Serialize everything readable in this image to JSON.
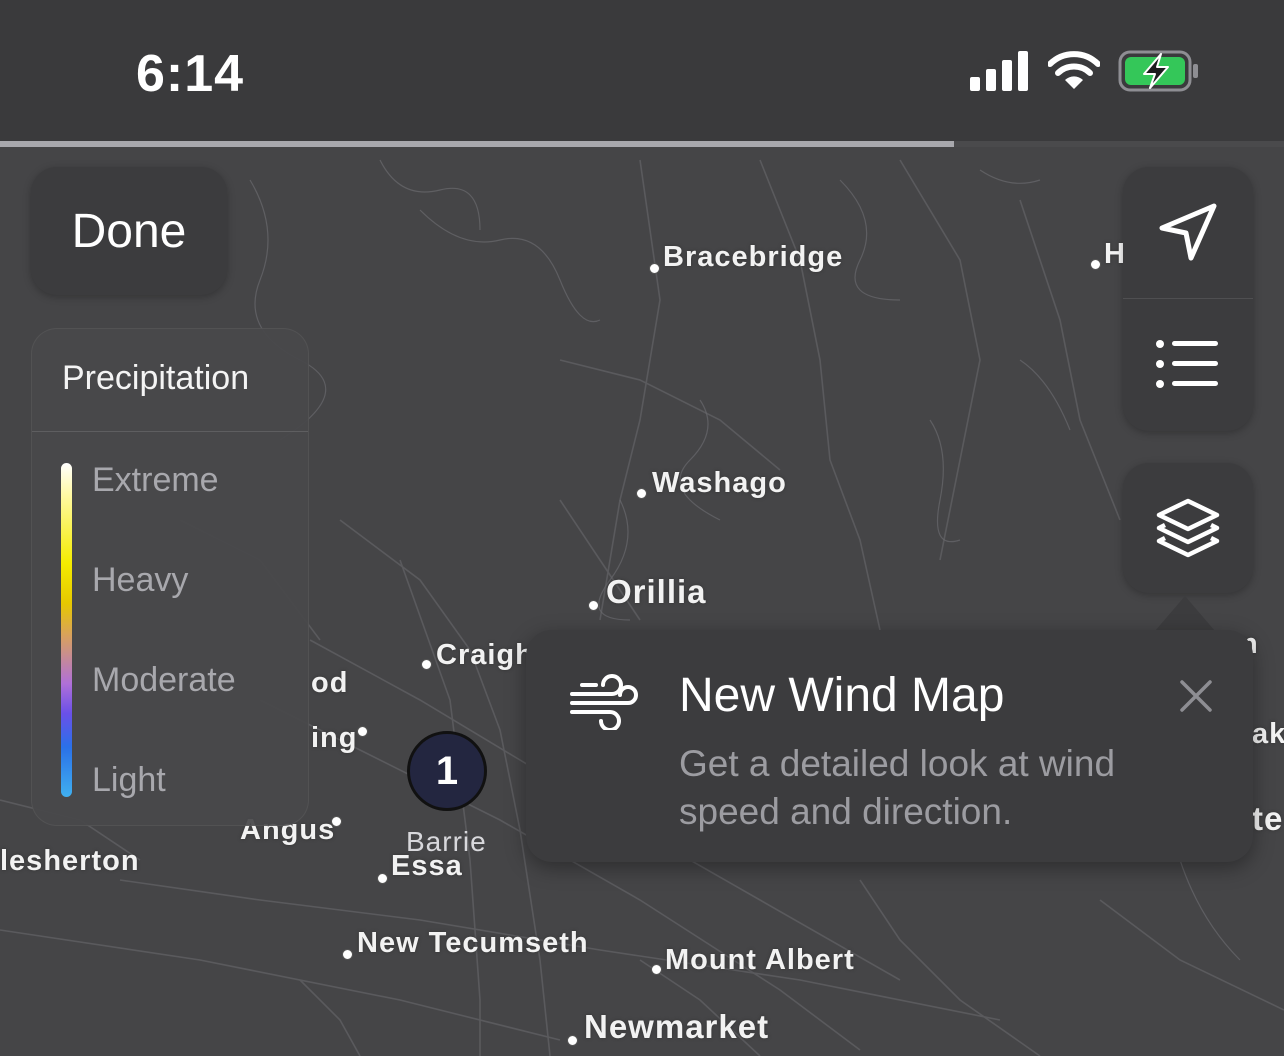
{
  "status_bar": {
    "time": "6:14",
    "icons": [
      "cellular-signal-icon",
      "wifi-icon",
      "battery-charging-icon"
    ],
    "battery_color": "#34c759"
  },
  "loading_progress": 0.743,
  "done_button": {
    "label": "Done"
  },
  "legend": {
    "title": "Precipitation",
    "levels": [
      "Extreme",
      "Heavy",
      "Moderate",
      "Light"
    ]
  },
  "controls": {
    "icons": [
      "location-arrow-icon",
      "list-icon",
      "layers-icon"
    ]
  },
  "map": {
    "places": [
      {
        "name": "Bracebridge"
      },
      {
        "name": "H"
      },
      {
        "name": "Washago"
      },
      {
        "name": "Orillia"
      },
      {
        "name": "Craigh"
      },
      {
        "name": "od"
      },
      {
        "name": "ing"
      },
      {
        "name": "Angus"
      },
      {
        "name": "lesherton"
      },
      {
        "name": "Essa"
      },
      {
        "name": "New Tecumseth"
      },
      {
        "name": "Mount Albert"
      },
      {
        "name": "Newmarket"
      },
      {
        "name": "n"
      },
      {
        "name": "ak"
      },
      {
        "name": "te"
      }
    ],
    "cluster": {
      "count": "1",
      "name": "Barrie"
    }
  },
  "popup": {
    "icon": "wind-icon",
    "title": "New Wind Map",
    "body": "Get a detailed look at wind speed and direction.",
    "close_icon": "close-icon"
  }
}
